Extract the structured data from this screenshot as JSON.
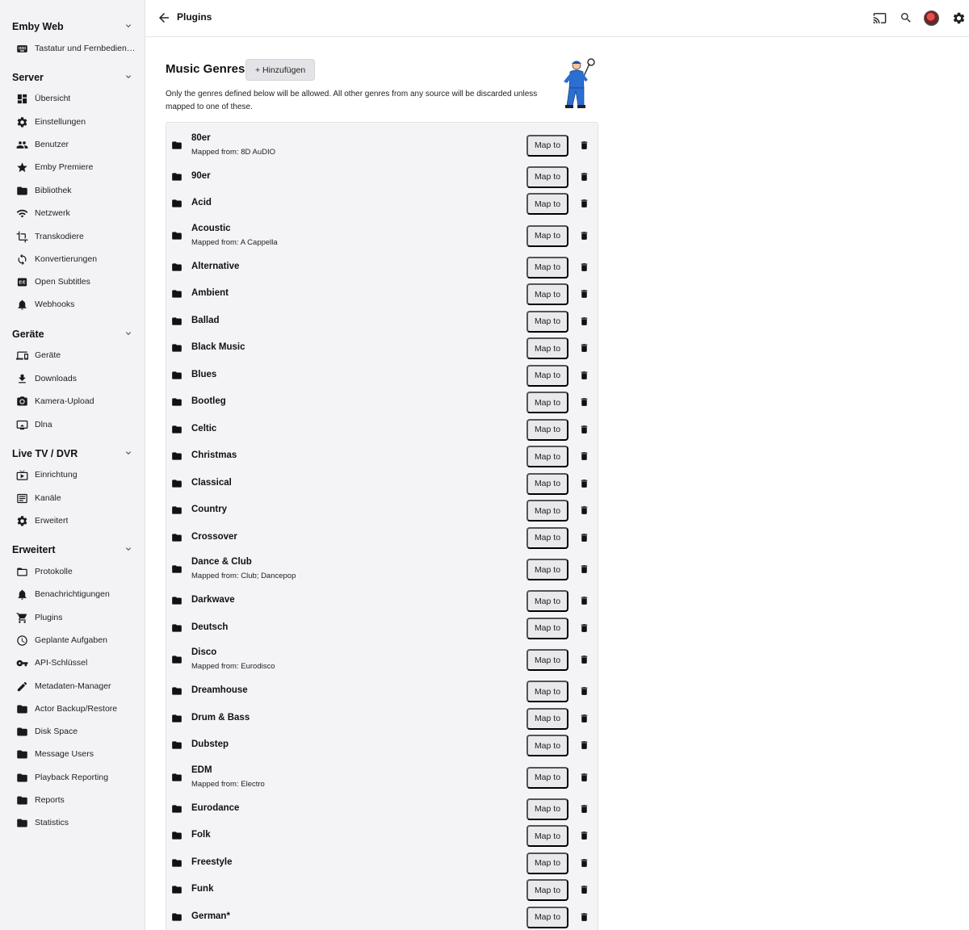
{
  "sidebar": {
    "sections": [
      {
        "title": "Emby Web",
        "items": [
          {
            "label": "Tastatur und Fernbedien…",
            "icon": "keyboard-icon"
          }
        ]
      },
      {
        "title": "Server",
        "items": [
          {
            "label": "Übersicht",
            "icon": "dashboard-icon"
          },
          {
            "label": "Einstellungen",
            "icon": "gear-icon"
          },
          {
            "label": "Benutzer",
            "icon": "users-icon"
          },
          {
            "label": "Emby Premiere",
            "icon": "star-icon"
          },
          {
            "label": "Bibliothek",
            "icon": "folder-icon"
          },
          {
            "label": "Netzwerk",
            "icon": "wifi-icon"
          },
          {
            "label": "Transkodiere",
            "icon": "crop-icon"
          },
          {
            "label": "Konvertierungen",
            "icon": "sync-icon"
          },
          {
            "label": "Open Subtitles",
            "icon": "closed-caption-icon"
          },
          {
            "label": "Webhooks",
            "icon": "bell-icon"
          }
        ]
      },
      {
        "title": "Geräte",
        "items": [
          {
            "label": "Geräte",
            "icon": "devices-icon"
          },
          {
            "label": "Downloads",
            "icon": "download-icon"
          },
          {
            "label": "Kamera-Upload",
            "icon": "camera-icon"
          },
          {
            "label": "Dlna",
            "icon": "cast-screen-icon"
          }
        ]
      },
      {
        "title": "Live TV / DVR",
        "items": [
          {
            "label": "Einrichtung",
            "icon": "live-tv-icon"
          },
          {
            "label": "Kanäle",
            "icon": "list-box-icon"
          },
          {
            "label": "Erweitert",
            "icon": "gear-icon"
          }
        ]
      },
      {
        "title": "Erweitert",
        "items": [
          {
            "label": "Protokolle",
            "icon": "folder-outline-icon"
          },
          {
            "label": "Benachrichtigungen",
            "icon": "bell-icon"
          },
          {
            "label": "Plugins",
            "icon": "cart-icon"
          },
          {
            "label": "Geplante Aufgaben",
            "icon": "clock-icon"
          },
          {
            "label": "API-Schlüssel",
            "icon": "key-icon"
          },
          {
            "label": "Metadaten-Manager",
            "icon": "pencil-icon"
          },
          {
            "label": "Actor Backup/Restore",
            "icon": "folder-icon"
          },
          {
            "label": "Disk Space",
            "icon": "folder-icon"
          },
          {
            "label": "Message Users",
            "icon": "folder-icon"
          },
          {
            "label": "Playback Reporting",
            "icon": "folder-icon"
          },
          {
            "label": "Reports",
            "icon": "folder-icon"
          },
          {
            "label": "Statistics",
            "icon": "folder-icon"
          }
        ]
      }
    ]
  },
  "header": {
    "title": "Plugins"
  },
  "main": {
    "heading": "Music Genres",
    "add_label": "+ Hinzufügen",
    "description": "Only the genres defined below will be allowed. All other genres from any source will be discarded unless mapped to one of these.",
    "map_label": "Map to",
    "genres": [
      {
        "name": "80er",
        "mapped": "Mapped from: 8D AuDIO"
      },
      {
        "name": "90er",
        "mapped": ""
      },
      {
        "name": "Acid",
        "mapped": ""
      },
      {
        "name": "Acoustic",
        "mapped": "Mapped from: A Cappella"
      },
      {
        "name": "Alternative",
        "mapped": ""
      },
      {
        "name": "Ambient",
        "mapped": ""
      },
      {
        "name": "Ballad",
        "mapped": ""
      },
      {
        "name": "Black Music",
        "mapped": ""
      },
      {
        "name": "Blues",
        "mapped": ""
      },
      {
        "name": "Bootleg",
        "mapped": ""
      },
      {
        "name": "Celtic",
        "mapped": ""
      },
      {
        "name": "Christmas",
        "mapped": ""
      },
      {
        "name": "Classical",
        "mapped": ""
      },
      {
        "name": "Country",
        "mapped": ""
      },
      {
        "name": "Crossover",
        "mapped": ""
      },
      {
        "name": "Dance & Club",
        "mapped": "Mapped from: Club; Dancepop"
      },
      {
        "name": "Darkwave",
        "mapped": ""
      },
      {
        "name": "Deutsch",
        "mapped": ""
      },
      {
        "name": "Disco",
        "mapped": "Mapped from: Eurodisco"
      },
      {
        "name": "Dreamhouse",
        "mapped": ""
      },
      {
        "name": "Drum & Bass",
        "mapped": ""
      },
      {
        "name": "Dubstep",
        "mapped": ""
      },
      {
        "name": "EDM",
        "mapped": "Mapped from: Electro"
      },
      {
        "name": "Eurodance",
        "mapped": ""
      },
      {
        "name": "Folk",
        "mapped": ""
      },
      {
        "name": "Freestyle",
        "mapped": ""
      },
      {
        "name": "Funk",
        "mapped": ""
      },
      {
        "name": "German*",
        "mapped": ""
      }
    ]
  }
}
